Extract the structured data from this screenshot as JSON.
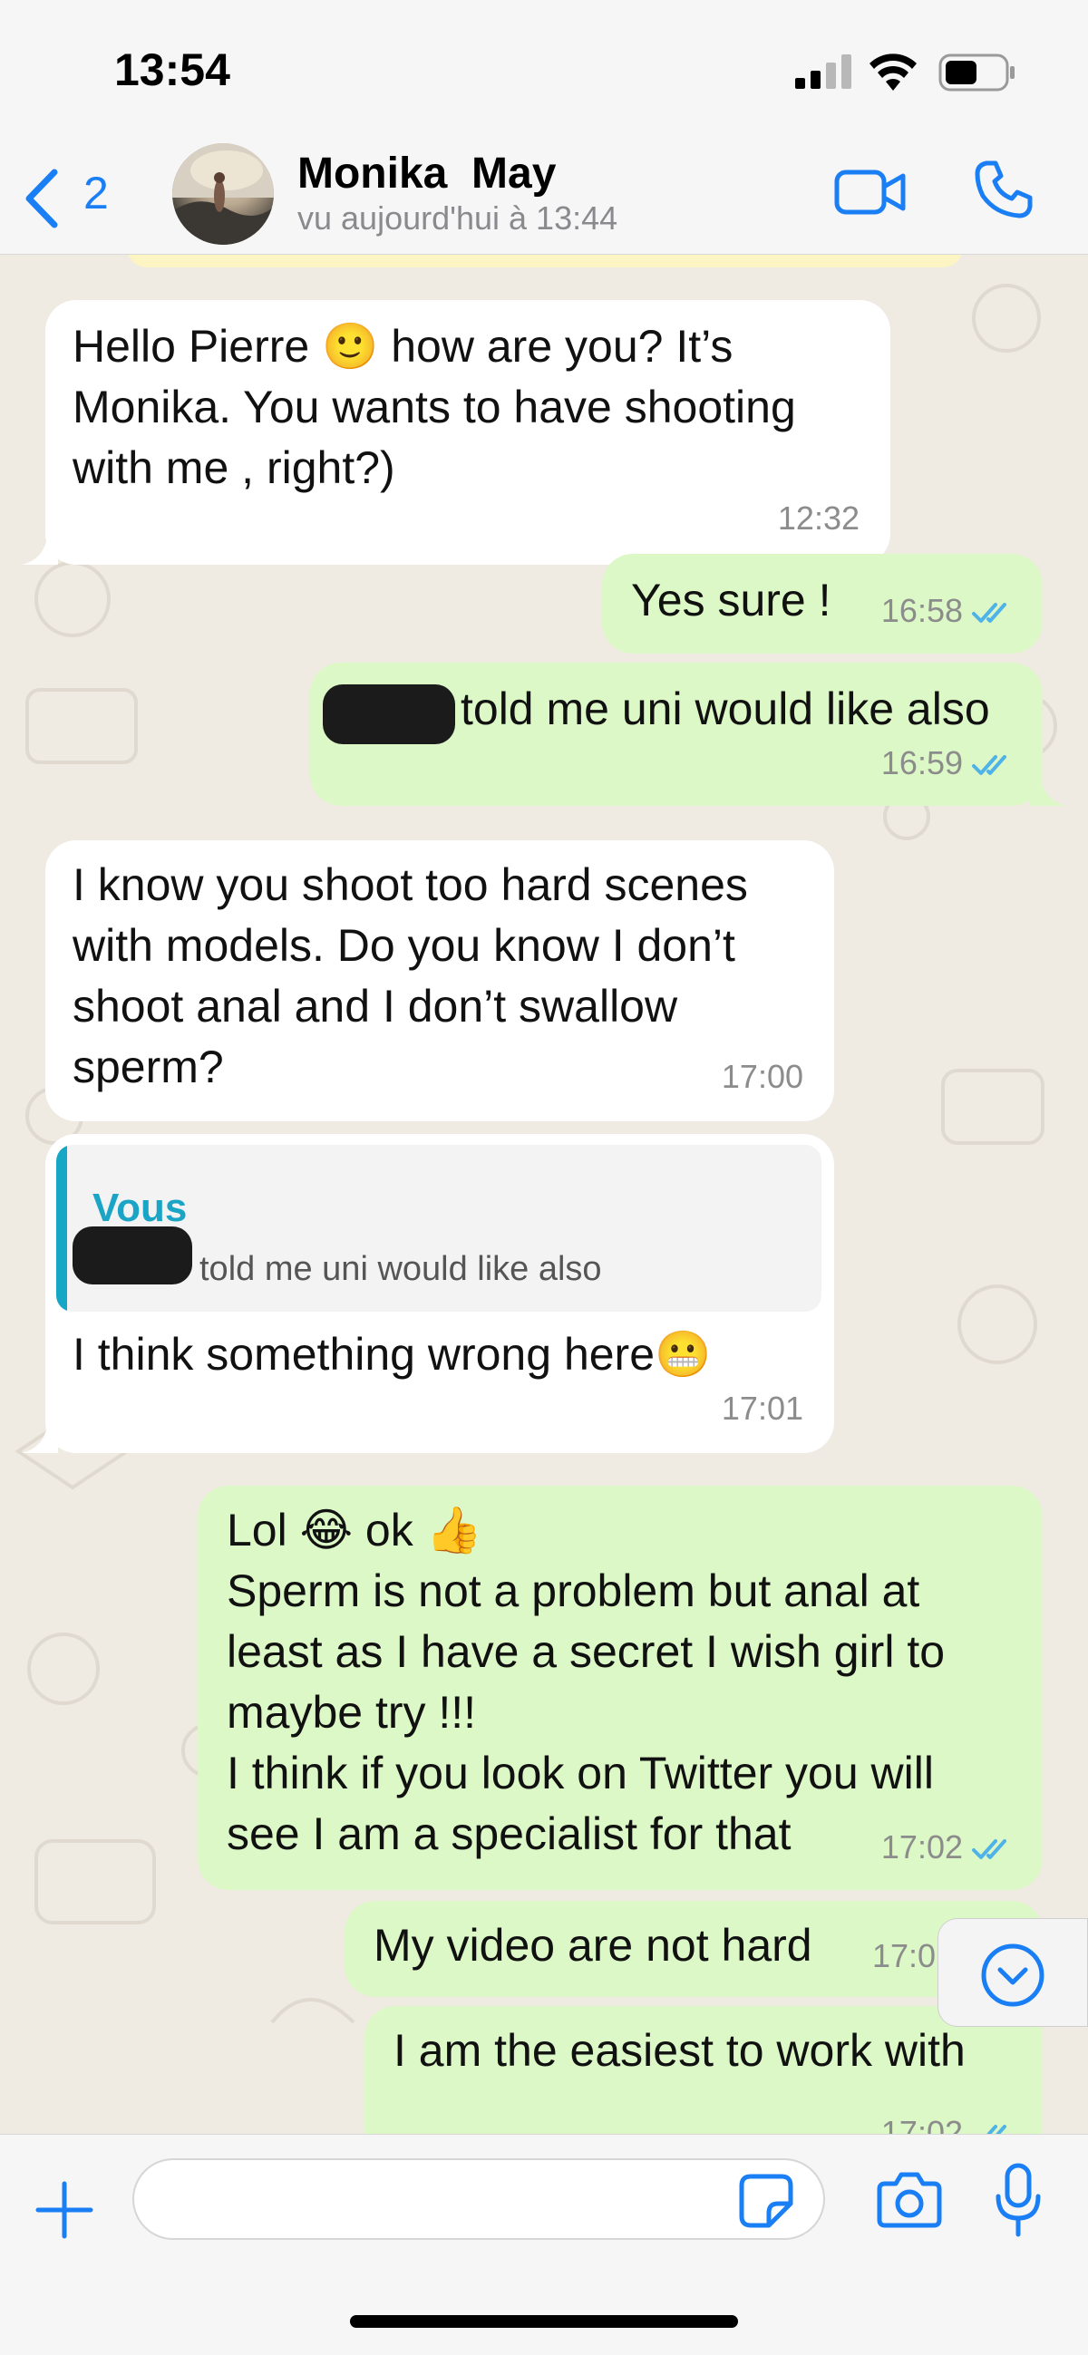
{
  "status_bar": {
    "time": "13:54",
    "battery_level": 0.55
  },
  "header": {
    "back_count": "2",
    "contact_name": "Monika  May",
    "contact_status": "vu aujourd'hui à 13:44"
  },
  "messages": [
    {
      "direction": "incoming",
      "text": "Hello Pierre 🙂 how are you? It’s\nMonika. You wants to have shooting\nwith me , right?)",
      "time": "12:32"
    },
    {
      "direction": "outgoing",
      "text": "Yes sure !",
      "time": "16:58",
      "status": "read"
    },
    {
      "direction": "outgoing",
      "text": "told me uni would like also",
      "time": "16:59",
      "status": "read",
      "redacted_prefix": true
    },
    {
      "direction": "incoming",
      "text": "I know you shoot too hard scenes\nwith models. Do you know I don’t\nshoot anal and I don’t swallow\nsperm?",
      "time": "17:00"
    },
    {
      "direction": "incoming",
      "reply_to": {
        "author": "Vous",
        "text": "told me uni would like also"
      },
      "text": "I think something wrong here😬",
      "time": "17:01"
    },
    {
      "direction": "outgoing",
      "text": "Lol 😂 ok 👍\nSperm is not a problem but anal at\nleast as I have a secret I wish girl to\nmaybe try !!!\nI think if you look on Twitter you will\nsee I am a specialist for that",
      "time": "17:02",
      "status": "read"
    },
    {
      "direction": "outgoing",
      "text": "My video are not hard",
      "time": "17:0",
      "status": "read"
    },
    {
      "direction": "outgoing",
      "text": "I am the easiest to work with",
      "time": "17:02",
      "status": "read"
    }
  ],
  "input": {
    "placeholder": ""
  },
  "colors": {
    "accent_blue": "#1a7ef5",
    "outgoing_bubble": "#dcf8c6",
    "incoming_bubble": "#ffffff",
    "chat_background": "#efeae2",
    "read_tick": "#4fb3e8",
    "reply_accent": "#1aa5c6"
  },
  "icons": [
    "back-chevron-icon",
    "video-call-icon",
    "phone-icon",
    "plus-icon",
    "sticker-icon",
    "camera-icon",
    "microphone-icon",
    "chevron-down-icon",
    "read-ticks-icon"
  ]
}
